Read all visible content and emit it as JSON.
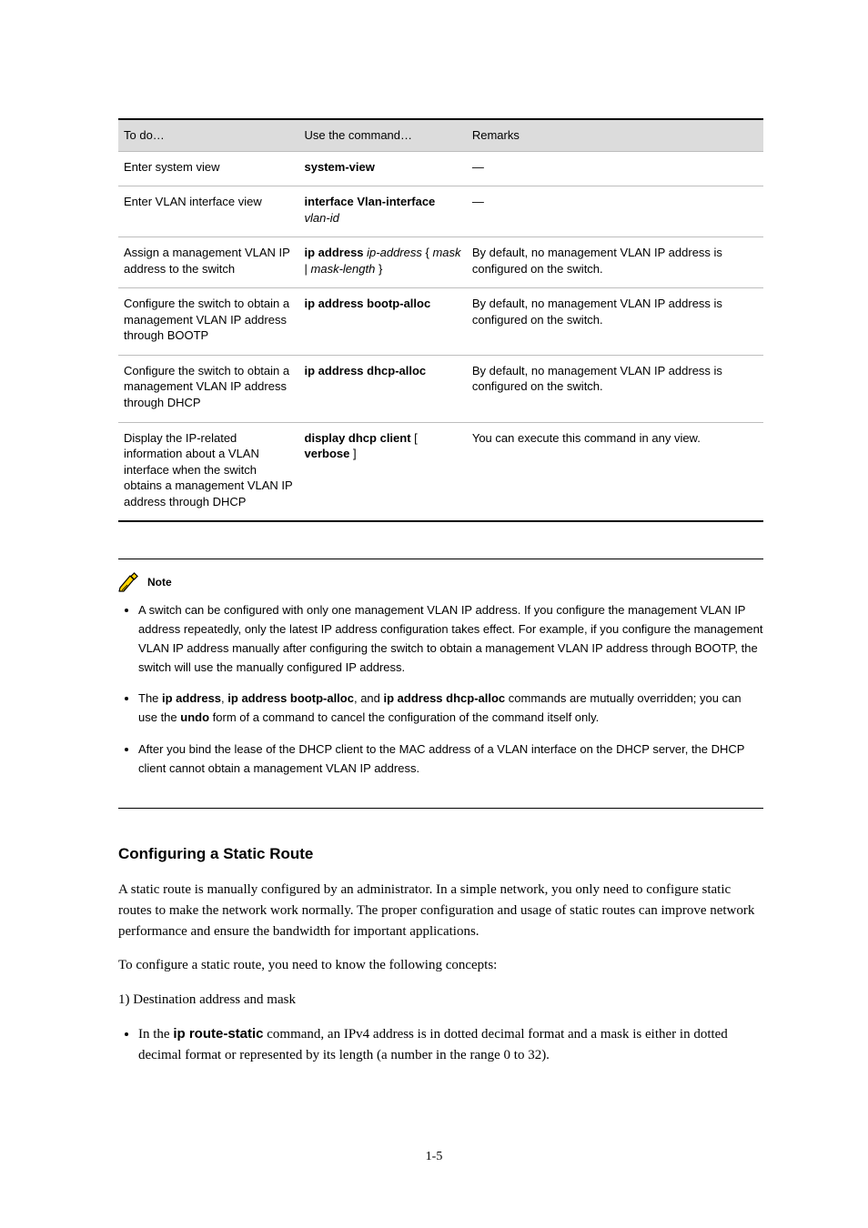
{
  "table": {
    "headers": {
      "todo": "To do…",
      "use": "Use the command…",
      "remarks": "Remarks"
    },
    "rows": [
      {
        "todo": "Enter system view",
        "use_html": "<span class=\"cmd-bold\">system-view</span>",
        "remarks": "—"
      },
      {
        "todo": "Enter VLAN interface view",
        "use_html": "<span class=\"cmd-bold\">interface Vlan-interface</span> <span class=\"cmd-italic\">vlan-id</span>",
        "remarks": "—"
      },
      {
        "todo": "Assign a management VLAN IP address to the switch",
        "use_html": "<span class=\"cmd-bold\">ip address</span> <span class=\"cmd-italic\">ip-address</span> { <span class=\"cmd-italic\">mask</span> | <span class=\"cmd-italic\">mask-length</span> }",
        "remarks": "By default, no management VLAN IP address is configured on the switch."
      },
      {
        "todo": "Configure the switch to obtain a management VLAN IP address through BOOTP",
        "use_html": "<span class=\"cmd-bold\">ip address bootp-alloc</span>",
        "remarks": "By default, no management VLAN IP address is configured on the switch."
      },
      {
        "todo": "Configure the switch to obtain a management VLAN IP address through DHCP",
        "use_html": "<span class=\"cmd-bold\">ip address dhcp-alloc</span>",
        "remarks": "By default, no management VLAN IP address is configured on the switch."
      },
      {
        "todo": "Display the IP-related information about a VLAN interface when the switch obtains a management VLAN IP address through DHCP",
        "use_html": "<span class=\"cmd-bold\">display dhcp client</span> [ <span class=\"cmd-bold\">verbose</span> ]",
        "remarks": "You can execute this command in any view."
      }
    ]
  },
  "note": {
    "label": "Note",
    "bullets": [
      "A switch can be configured with only one management VLAN IP address. If you configure the management VLAN IP address repeatedly, only the latest IP address configuration takes effect. For example, if you configure the management VLAN IP address manually after configuring the switch to obtain a management VLAN IP address through BOOTP, the switch will use the manually configured IP address.",
      "The <span class=\"cmd-bold\">ip address</span>, <span class=\"cmd-bold\">ip address bootp-alloc</span>, and <span class=\"cmd-bold\">ip address dhcp-alloc</span> commands are mutually overridden; you can use the <span class=\"cmd-bold\">undo</span> form of a command to cancel the configuration of the command itself only.",
      "After you bind the lease of the DHCP client to the MAC address of a VLAN interface on the DHCP server, the DHCP client cannot obtain a management VLAN IP address."
    ]
  },
  "heading": "Configuring a Static Route",
  "paragraphs": [
    "A static route is manually configured by an administrator. In a simple network, you only need to configure static routes to make the network work normally. The proper configuration and usage of static routes can improve network performance and ensure the bandwidth for important applications.",
    "To configure a static route, you need to know the following concepts:",
    "1) Destination address and mask"
  ],
  "list_item": "In the <span class=\"body-bold\">ip route-static</span> command, an IPv4 address is in dotted decimal format and a mask is either in dotted decimal format or represented by its length (a number in the range 0 to 32).",
  "page_number": "1-5"
}
